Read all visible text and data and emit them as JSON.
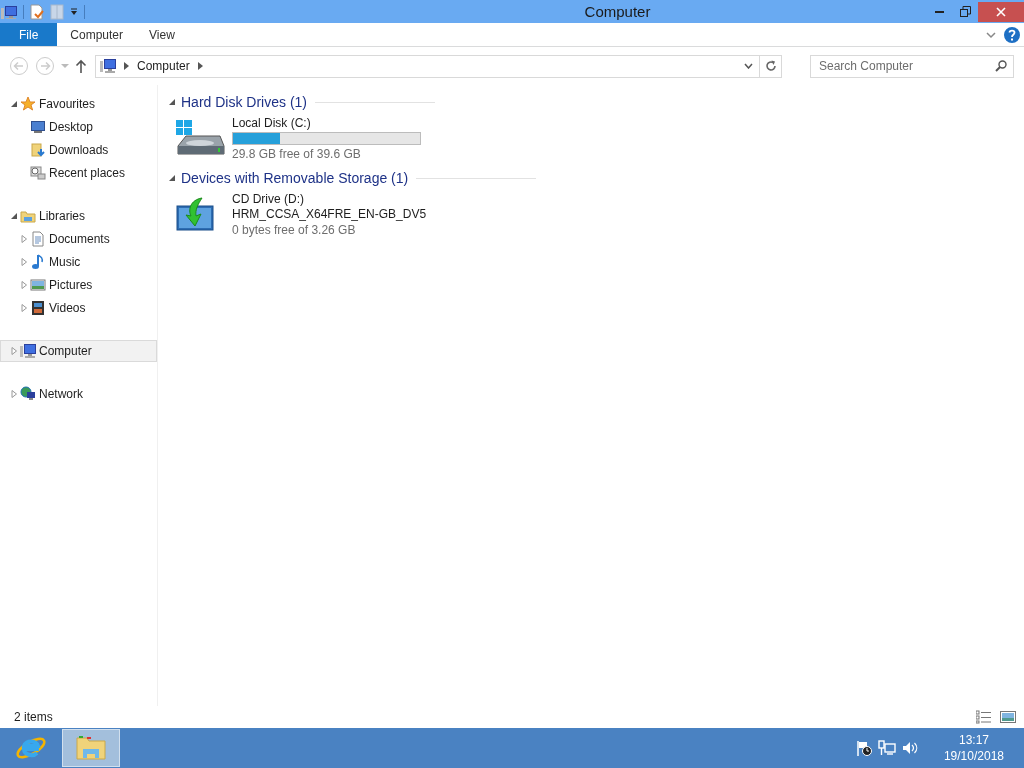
{
  "window": {
    "title": "Computer"
  },
  "ribbon_tabs": [
    {
      "label": "File",
      "kind": "file"
    },
    {
      "label": "Computer",
      "kind": "tab"
    },
    {
      "label": "View",
      "kind": "tab"
    }
  ],
  "address": {
    "path": [
      "Computer"
    ]
  },
  "search": {
    "placeholder": "Search Computer"
  },
  "navigation": [
    {
      "label": "Favourites",
      "kind": "star",
      "expanded": true,
      "selected": false,
      "children": [
        {
          "label": "Desktop",
          "kind": "desktop",
          "selected": false
        },
        {
          "label": "Downloads",
          "kind": "downloads",
          "selected": false
        },
        {
          "label": "Recent places",
          "kind": "recent",
          "selected": false
        }
      ]
    },
    {
      "label": "Libraries",
      "kind": "library",
      "expanded": true,
      "selected": false,
      "children": [
        {
          "label": "Documents",
          "kind": "documents",
          "expanded": false,
          "selected": false
        },
        {
          "label": "Music",
          "kind": "music",
          "expanded": false,
          "selected": false
        },
        {
          "label": "Pictures",
          "kind": "pictures",
          "expanded": false,
          "selected": false
        },
        {
          "label": "Videos",
          "kind": "videos",
          "expanded": false,
          "selected": false
        }
      ]
    },
    {
      "label": "Computer",
      "kind": "computer",
      "expanded": false,
      "selected": true
    },
    {
      "label": "Network",
      "kind": "network",
      "expanded": false,
      "selected": false
    }
  ],
  "sections": [
    {
      "title": "Hard Disk Drives (1)",
      "expanded": true,
      "items": [
        {
          "kind": "hard-disk",
          "name": "Local Disk (C:)",
          "level": 0.25,
          "detail": "29.8 GB free of 39.6 GB"
        }
      ]
    },
    {
      "title": "Devices with Removable Storage (1)",
      "expanded": true,
      "items": [
        {
          "kind": "cd-drive",
          "name": "CD Drive (D:)",
          "label": "HRM_CCSA_X64FRE_EN-GB_DV5",
          "detail": "0 bytes free of 3.26 GB"
        }
      ]
    }
  ],
  "status_bar": {
    "items": "2 items"
  },
  "taskbar": {
    "apps": [
      {
        "kind": "browser",
        "selected": false
      },
      {
        "kind": "explorer",
        "selected": true
      }
    ],
    "time": "13:17",
    "date": "19/10/2018"
  }
}
